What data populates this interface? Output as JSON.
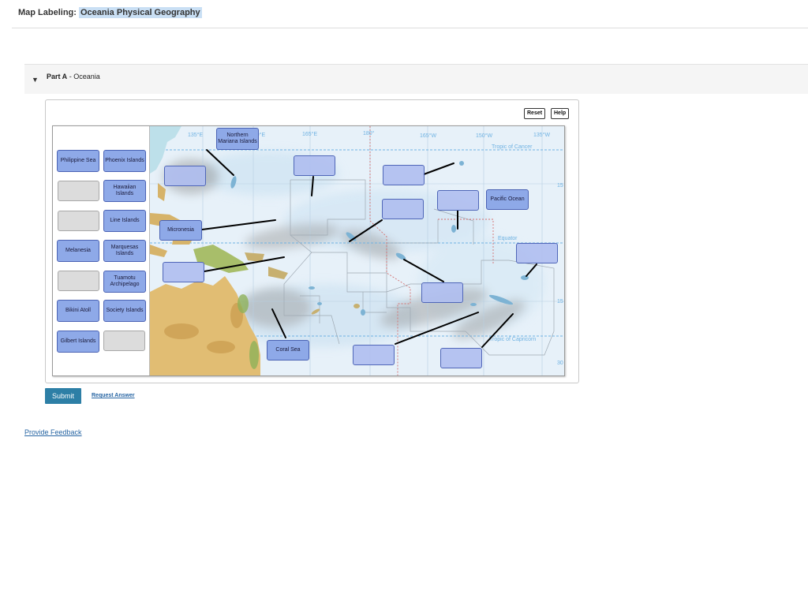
{
  "header": {
    "prefix": "Map Labeling: ",
    "title": "Oceania Physical Geography"
  },
  "part": {
    "name": "Part A",
    "separator": " - ",
    "subtitle": "Oceania"
  },
  "toolbar": {
    "reset_label": "Reset",
    "help_label": "Help"
  },
  "bank_labels": [
    "Philippine Sea",
    "Phoenix Islands",
    "Hawaiian Islands",
    "Line Islands",
    "Melanesia",
    "Marquesas Islands",
    "Tuamotu Archipelago",
    "Bikini Atoll",
    "Society Islands",
    "Gilbert Islands"
  ],
  "placed_labels": [
    "Northern Mariana Islands",
    "Micronesia",
    "Coral Sea",
    "Pacific Ocean"
  ],
  "map": {
    "longitudes": [
      "135°E",
      "150°E",
      "165°E",
      "180°",
      "165°W",
      "150°W",
      "135°W"
    ],
    "lines": [
      "Tropic of Cancer",
      "Equator",
      "Tropic of Capricorn"
    ],
    "edge_latitudes": [
      "15",
      "15",
      "30"
    ]
  },
  "actions": {
    "submit_label": "Submit",
    "request_answer_label": "Request Answer"
  },
  "footer": {
    "feedback_label": "Provide Feedback"
  },
  "colors": {
    "label_fill": "#8ea9e8",
    "label_border": "#4a62b4",
    "submit": "#2d7fa6",
    "link": "#2765a3",
    "ocean": "#d6e8f5",
    "land": "#e2c27a"
  }
}
